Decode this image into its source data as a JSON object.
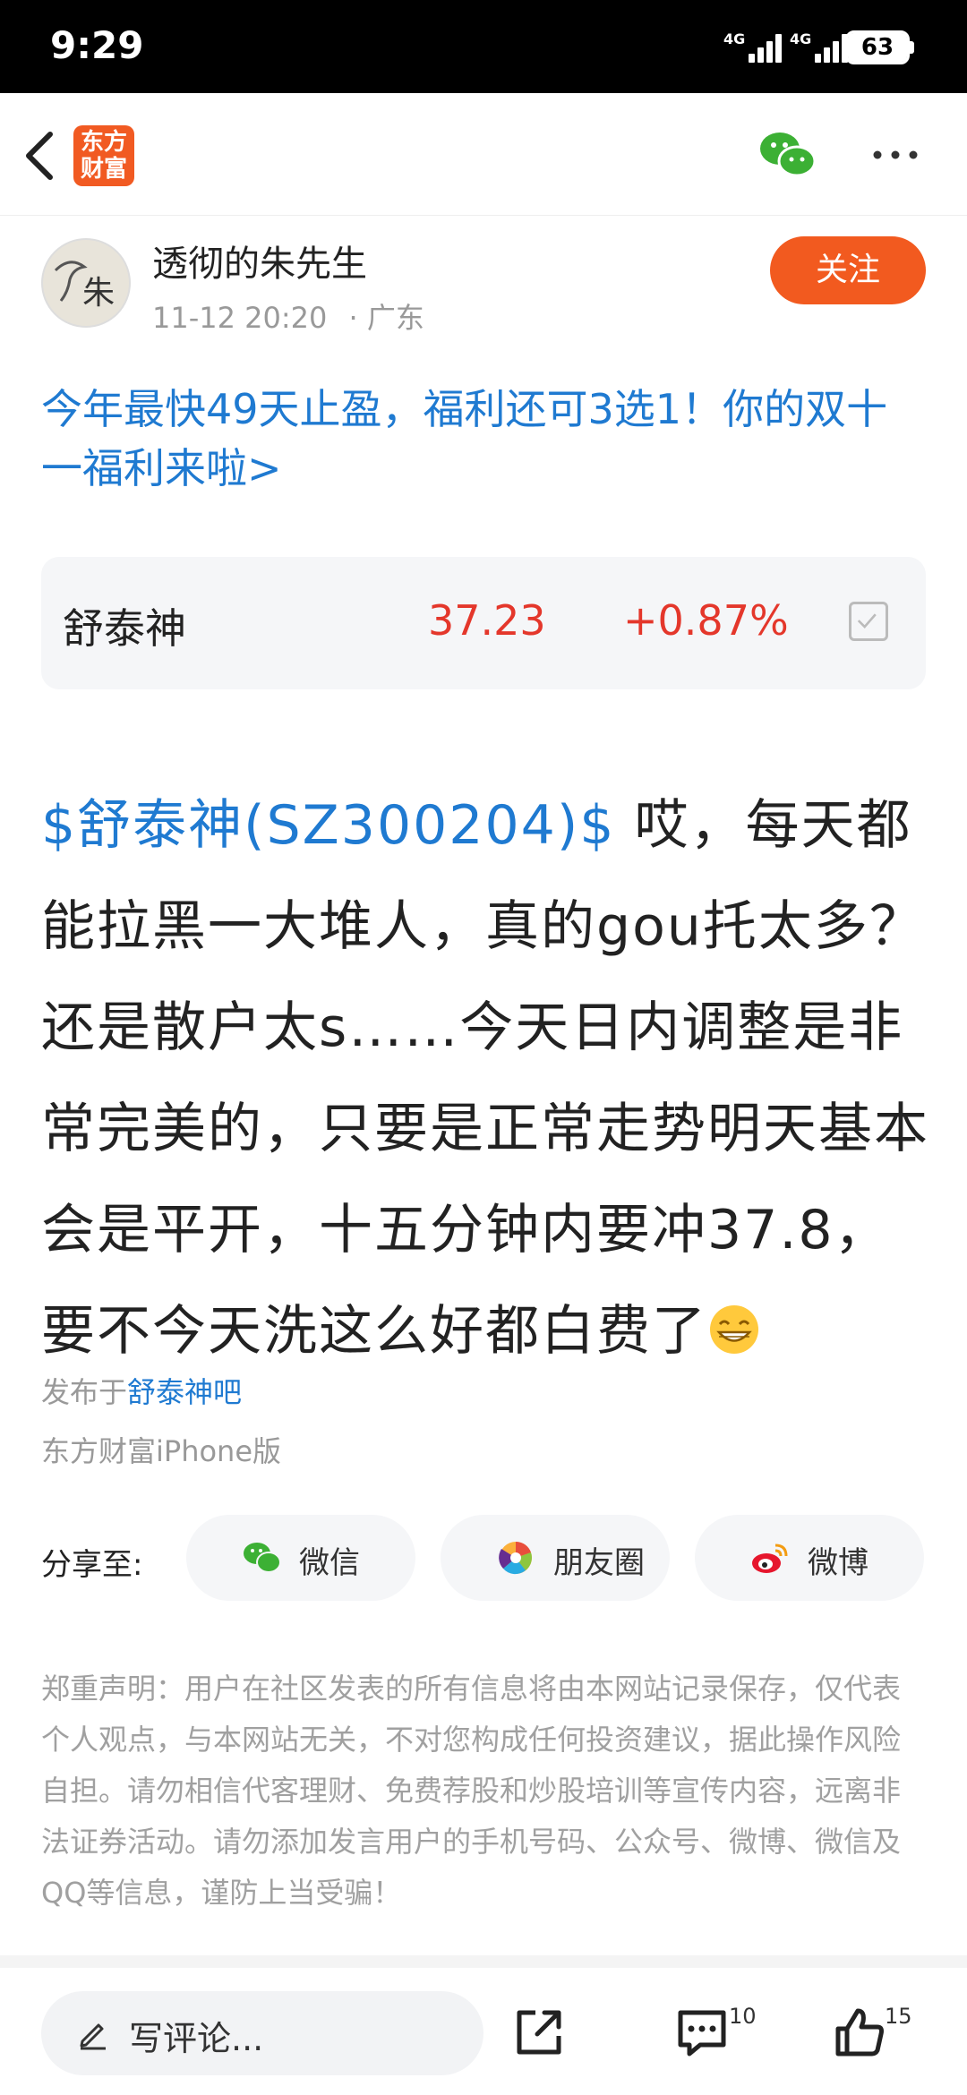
{
  "status": {
    "time": "9:29",
    "net1": "4G",
    "net2": "4G",
    "battery": "63"
  },
  "nav": {
    "logo_line1": "东方",
    "logo_line2": "财富"
  },
  "author": {
    "name": "透彻的朱先生",
    "time": "11-12 20:20",
    "location": "· 广东",
    "follow_label": "关注",
    "avatar_char": "朱"
  },
  "promo": {
    "text": "今年最快49天止盈，福利还可3选1！你的双十一福利来啦>"
  },
  "stock": {
    "name": "舒泰神",
    "price": "37.23",
    "change": "+0.87%"
  },
  "post": {
    "tag": "$舒泰神(SZ300204)$",
    "text": " 哎，每天都能拉黑一大堆人，真的gou托太多？还是散户太s……今天日内调整是非常完美的，只要是正常走势明天基本会是平开，十五分钟内要冲37.8，要不今天洗这么好都白费了"
  },
  "publish": {
    "prefix": "发布于",
    "bar": "舒泰神吧",
    "client": "东方财富iPhone版"
  },
  "share": {
    "label": "分享至:",
    "wechat": "微信",
    "moments": "朋友圈",
    "weibo": "微博"
  },
  "disclaimer": "郑重声明：用户在社区发表的所有信息将由本网站记录保存，仅代表个人观点，与本网站无关，不对您构成任何投资建议，据此操作风险自担。请勿相信代客理财、免费荐股和炒股培训等宣传内容，远离非法证券活动。请勿添加发言用户的手机号码、公众号、微博、微信及QQ等信息，谨防上当受骗！",
  "bottom": {
    "comment_placeholder": "写评论...",
    "comment_count": "10",
    "like_count": "15"
  }
}
